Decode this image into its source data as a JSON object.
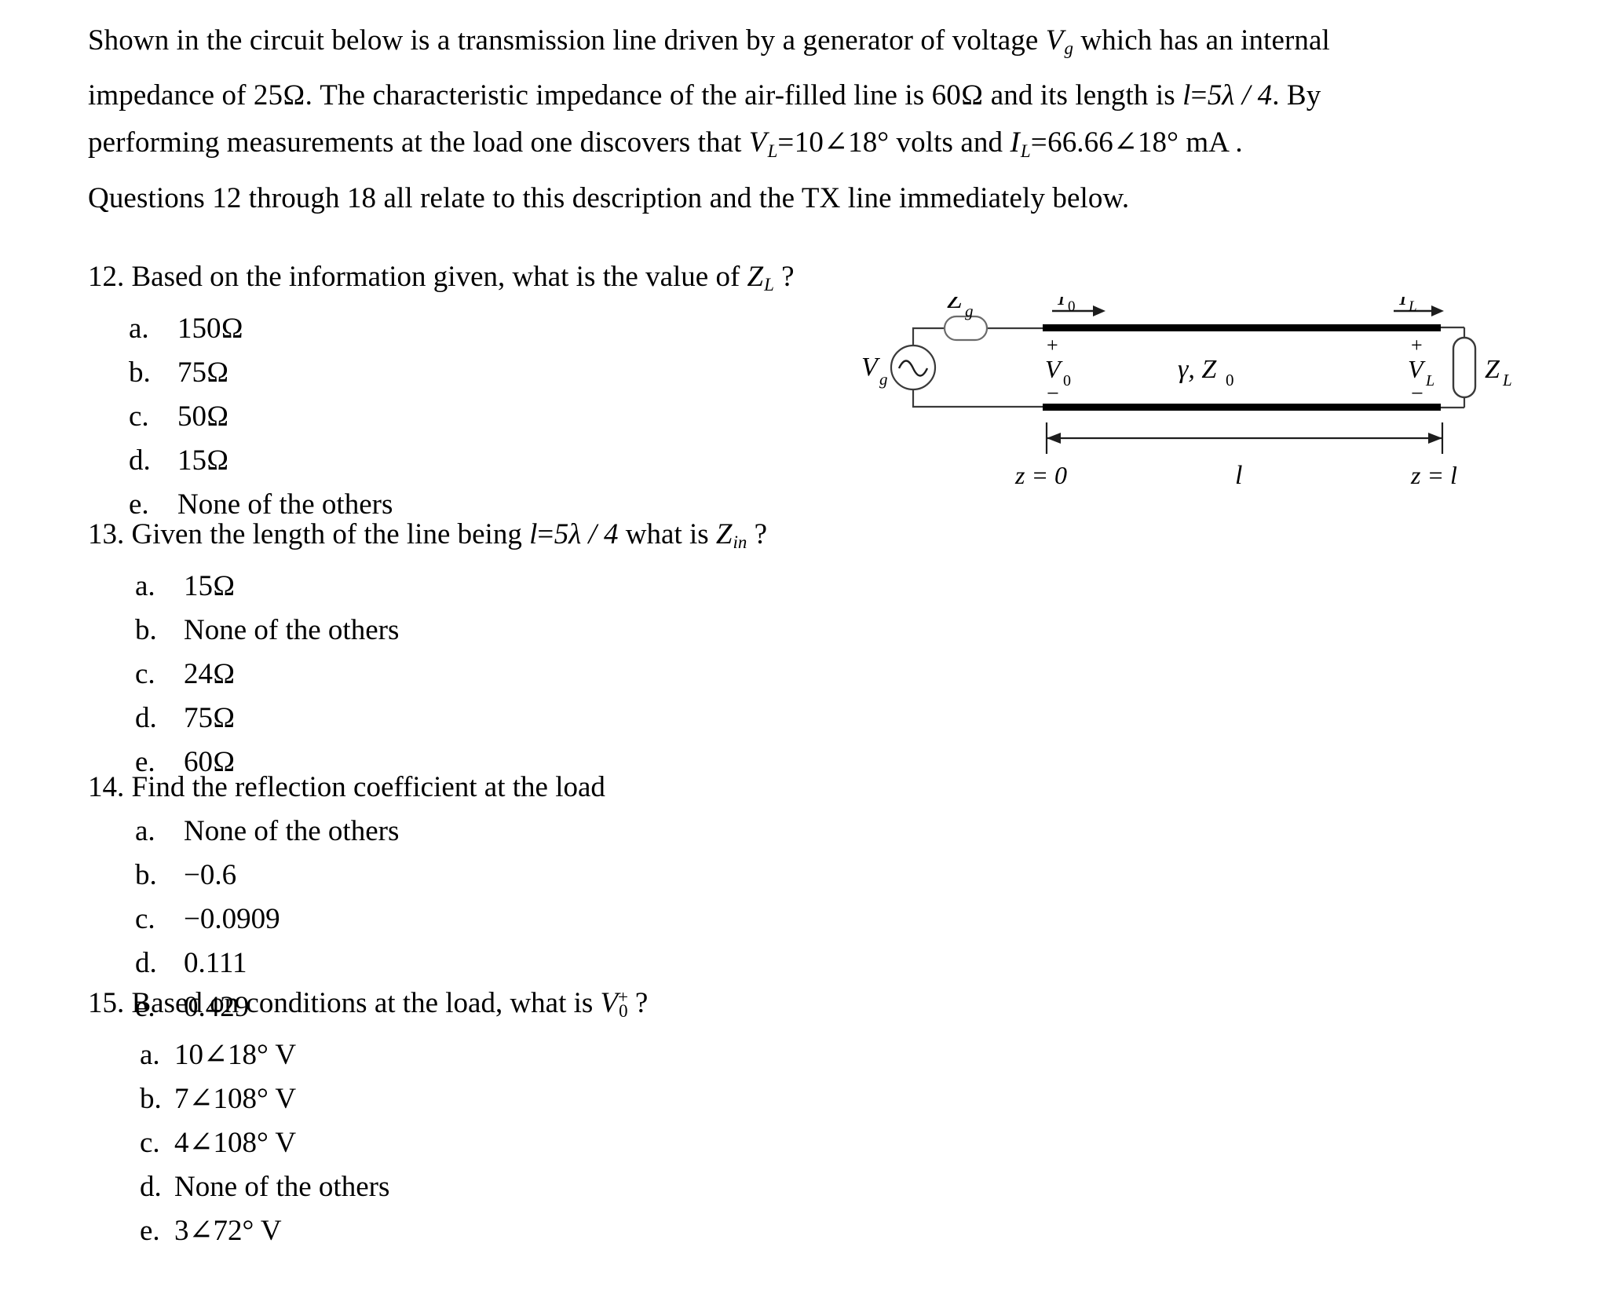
{
  "document": {
    "intro": {
      "line1_a": "Shown in the circuit below is a transmission line driven by a generator of voltage ",
      "line1_var": "V",
      "line1_var_sub": "g",
      "line1_b": " which has an internal",
      "line2_a": "impedance of ",
      "line2_val1": "25Ω",
      "line2_b": ".  The characteristic impedance of the air-filled line is ",
      "line2_val2": "60Ω",
      "line2_c": " and its length is ",
      "line2_len_lhs": "l",
      "line2_len_eq": "=",
      "line2_len_rhs": "5λ / 4",
      "line2_d": ".  By",
      "line3_a": "performing measurements at the load one discovers that ",
      "line3_var1": "V",
      "line3_var1_sub": "L",
      "line3_eq1": "=",
      "line3_val1": "10∠18°",
      "line3_unit1": " volts  and  ",
      "line3_var2": "I",
      "line3_var2_sub": "L",
      "line3_eq2": "=",
      "line3_val2": "66.66∠18°",
      "line3_unit2": " mA .",
      "line4": "Questions 12 through 18 all relate to this description and the TX line immediately below."
    },
    "questions": [
      {
        "number": "12.",
        "stem_a": "Based on the information given, what is the value of ",
        "stem_var": "Z",
        "stem_var_sub": "L",
        "stem_b": " ?",
        "choices": [
          {
            "label": "a.",
            "text": "150Ω"
          },
          {
            "label": "b.",
            "text": "75Ω"
          },
          {
            "label": "c.",
            "text": "50Ω"
          },
          {
            "label": "d.",
            "text": "15Ω"
          },
          {
            "label": "e.",
            "text": "None of the others"
          }
        ]
      },
      {
        "number": "13.",
        "stem_a": "Given the length of the line being ",
        "stem_math_lhs": "l",
        "stem_math_eq": "=",
        "stem_math_rhs": "5λ / 4",
        "stem_mid": " what is ",
        "stem_var": "Z",
        "stem_var_sub": "in",
        "stem_b": " ?",
        "choices": [
          {
            "label": "a.",
            "text": "15Ω"
          },
          {
            "label": "b.",
            "text": "None of the others"
          },
          {
            "label": "c.",
            "text": "24Ω"
          },
          {
            "label": "d.",
            "text": "75Ω"
          },
          {
            "label": "e.",
            "text": "60Ω"
          }
        ]
      },
      {
        "number": "14.",
        "stem_a": "Find the reflection coefficient at the load",
        "choices": [
          {
            "label": "a.",
            "text": "None of the others"
          },
          {
            "label": "b.",
            "text": "−0.6"
          },
          {
            "label": "c.",
            "text": "−0.0909"
          },
          {
            "label": "d.",
            "text": "0.111"
          },
          {
            "label": "e.",
            "text": "0.429"
          }
        ]
      },
      {
        "number": "15.",
        "stem_a": "Based on conditions at the load, what is ",
        "stem_var": "V",
        "stem_var_sub": "0",
        "stem_var_sup": "+",
        "stem_b": " ?",
        "choices": [
          {
            "label": "a.",
            "text": "10∠18° V"
          },
          {
            "label": "b.",
            "text": "7∠108° V"
          },
          {
            "label": "c.",
            "text": "4∠108° V"
          },
          {
            "label": "d.",
            "text": "None of the others"
          },
          {
            "label": "e.",
            "text": "3∠72° V"
          }
        ]
      }
    ],
    "figure": {
      "caption_source": "transmission-line-schematic",
      "labels": {
        "source_voltage": "V",
        "source_voltage_sub": "g",
        "series_impedance": "Z",
        "series_impedance_sub": "g",
        "input_current": "I",
        "input_current_sub": "0",
        "input_voltage": "V",
        "input_voltage_sub": "0",
        "input_plus": "+",
        "input_minus": "−",
        "line_params": "γ, Z",
        "line_params_sub": "0",
        "load_current": "I",
        "load_current_sub": "L",
        "load_voltage": "V",
        "load_voltage_sub": "L",
        "load_plus": "+",
        "load_minus": "−",
        "load_impedance": "Z",
        "load_impedance_sub": "L",
        "origin": "z = 0",
        "length": "l",
        "end": "z = l"
      }
    }
  }
}
